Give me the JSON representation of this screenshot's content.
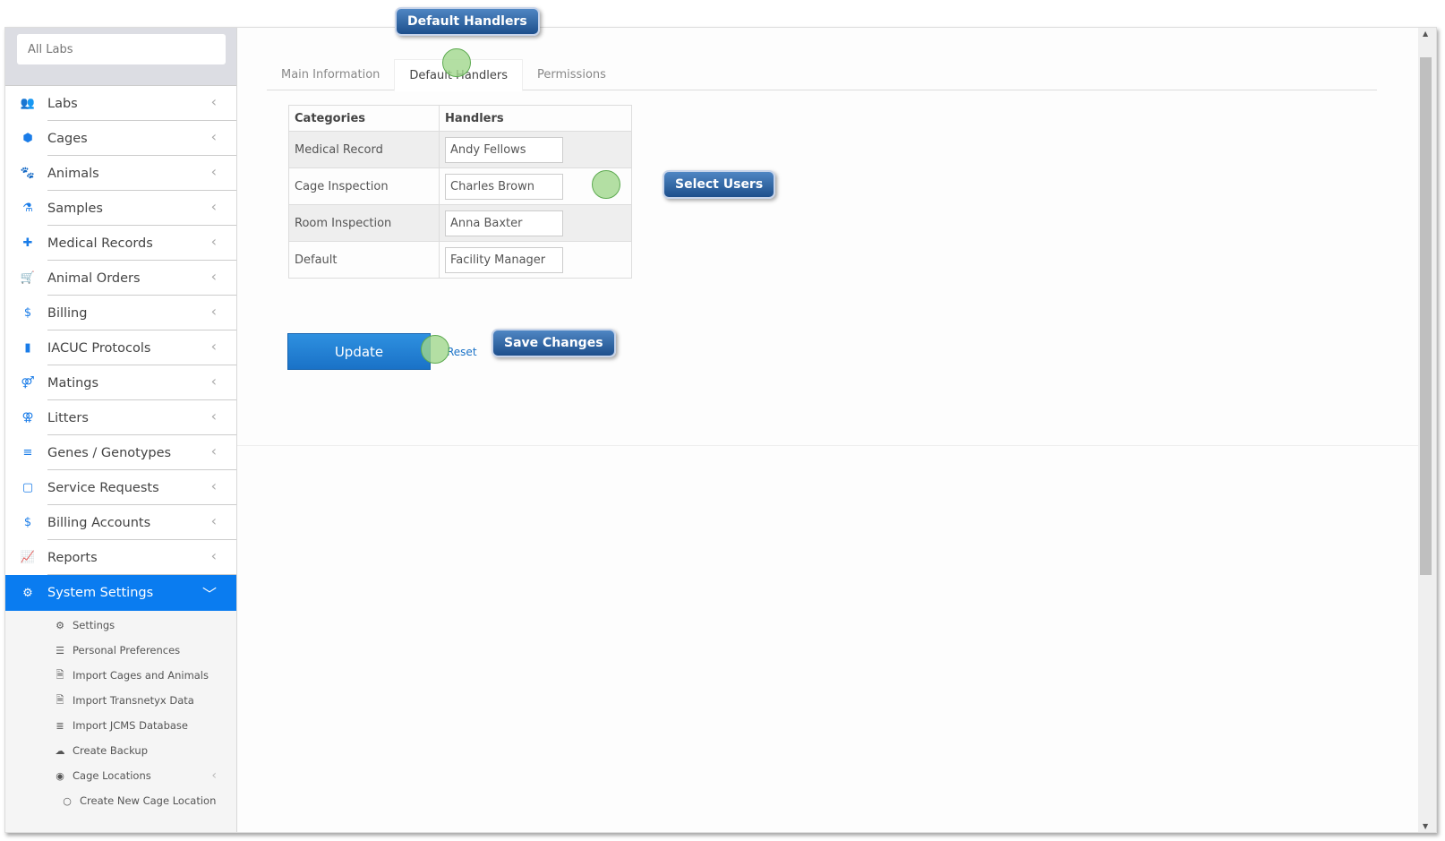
{
  "sidebar": {
    "lab_filter": {
      "placeholder": "All Labs"
    },
    "items": [
      {
        "label": "Labs",
        "icon": "users-icon"
      },
      {
        "label": "Cages",
        "icon": "cube-icon"
      },
      {
        "label": "Animals",
        "icon": "paw-icon"
      },
      {
        "label": "Samples",
        "icon": "flask-icon"
      },
      {
        "label": "Medical Records",
        "icon": "medkit-icon"
      },
      {
        "label": "Animal Orders",
        "icon": "cart-icon"
      },
      {
        "label": "Billing",
        "icon": "dollar-icon"
      },
      {
        "label": "IACUC Protocols",
        "icon": "book-icon"
      },
      {
        "label": "Matings",
        "icon": "mating-icon"
      },
      {
        "label": "Litters",
        "icon": "litter-icon"
      },
      {
        "label": "Genes / Genotypes",
        "icon": "list-icon"
      },
      {
        "label": "Service Requests",
        "icon": "note-icon"
      },
      {
        "label": "Billing Accounts",
        "icon": "dollar-icon"
      },
      {
        "label": "Reports",
        "icon": "chart-icon"
      },
      {
        "label": "System Settings",
        "icon": "gear-icon",
        "active": true
      }
    ],
    "sub_items": [
      {
        "label": "Settings",
        "icon": "gear-icon"
      },
      {
        "label": "Personal Preferences",
        "icon": "sliders-icon"
      },
      {
        "label": "Import Cages and Animals",
        "icon": "excel-file-icon"
      },
      {
        "label": "Import Transnetyx Data",
        "icon": "file-icon"
      },
      {
        "label": "Import JCMS Database",
        "icon": "database-icon"
      },
      {
        "label": "Create Backup",
        "icon": "cloud-download-icon"
      },
      {
        "label": "Cage Locations",
        "icon": "target-icon"
      },
      {
        "label": "Create New Cage Location",
        "icon": "circle-icon"
      }
    ]
  },
  "tabs": [
    {
      "label": "Main Information"
    },
    {
      "label": "Default Handlers",
      "active": true
    },
    {
      "label": "Permissions"
    }
  ],
  "table": {
    "headers": [
      "Categories",
      "Handlers"
    ],
    "rows": [
      {
        "category": "Medical Record",
        "handler": "Andy Fellows"
      },
      {
        "category": "Cage Inspection",
        "handler": "Charles Brown"
      },
      {
        "category": "Room Inspection",
        "handler": "Anna Baxter"
      },
      {
        "category": "Default",
        "handler": "Facility Manager"
      }
    ]
  },
  "actions": {
    "update": "Update",
    "reset": "Reset"
  },
  "callouts": {
    "default_handlers": "Default Handlers",
    "select_users": "Select Users",
    "save_changes": "Save Changes"
  },
  "colors": {
    "accent": "#0a7cf0",
    "button": "#1a72c7",
    "callout": "#2b5f9e"
  }
}
